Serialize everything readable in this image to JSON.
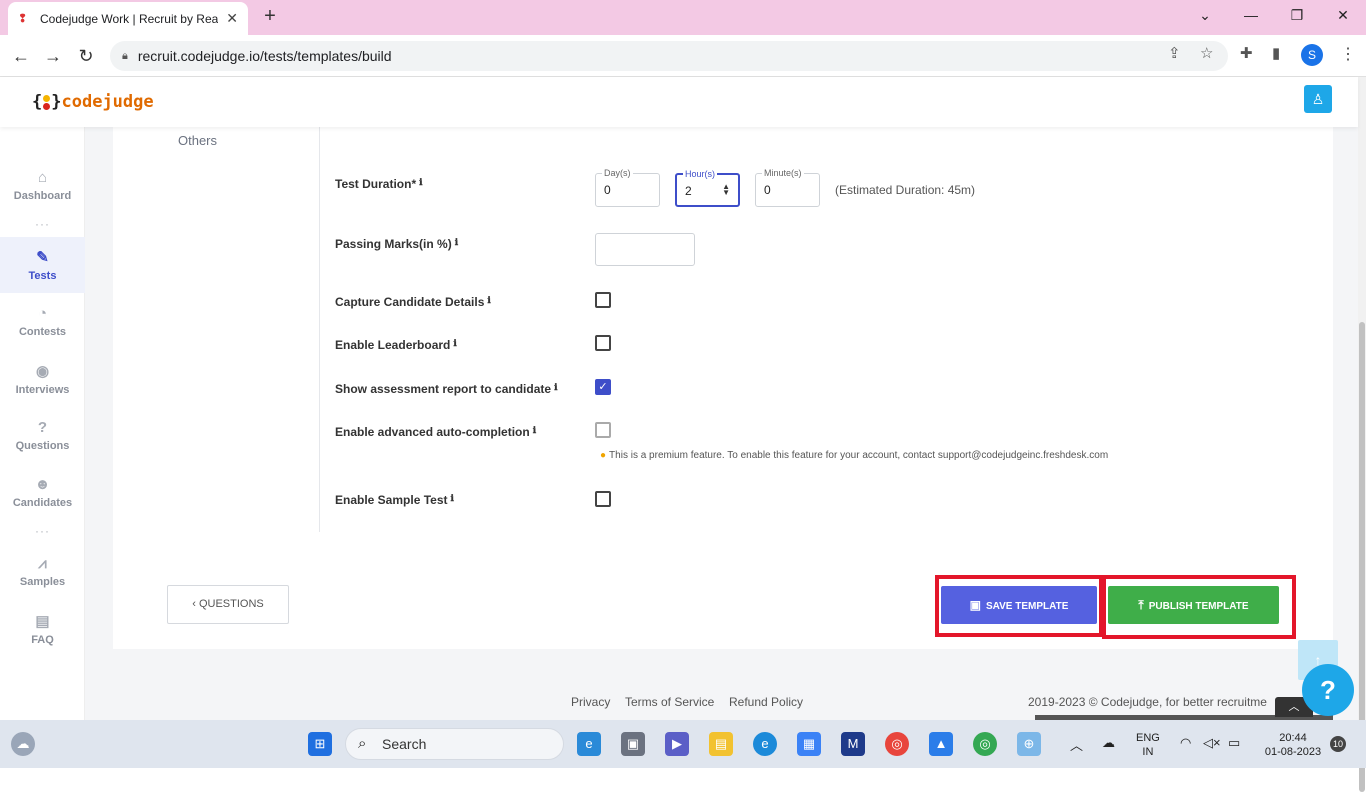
{
  "browser": {
    "tab_title": "Codejudge Work | Recruit by Rea",
    "tab_favicon": "❢",
    "new_tab": "+",
    "url": "recruit.codejudge.io/tests/templates/build",
    "profile_initial": "S"
  },
  "app": {
    "logo_text": "codejudge"
  },
  "sidebar": {
    "items": [
      {
        "label": "Dashboard",
        "icon": "home-icon"
      },
      {
        "label": "Tests",
        "icon": "pen-icon"
      },
      {
        "label": "Contests",
        "icon": "pie-chart-icon"
      },
      {
        "label": "Interviews",
        "icon": "podcast-icon"
      },
      {
        "label": "Questions",
        "icon": "question-circle-icon"
      },
      {
        "label": "Candidates",
        "icon": "users-icon"
      },
      {
        "label": "Samples",
        "icon": "line-chart-icon"
      },
      {
        "label": "FAQ",
        "icon": "chat-icon"
      }
    ]
  },
  "form": {
    "section_label": "Others",
    "test_duration_label": "Test Duration*",
    "days_label": "Day(s)",
    "days_value": "0",
    "hours_label": "Hour(s)",
    "hours_value": "2",
    "minutes_label": "Minute(s)",
    "minutes_value": "0",
    "estimated": "(Estimated Duration: 45m)",
    "passing_marks_label": "Passing Marks(in %)",
    "passing_marks_value": "",
    "capture_label": "Capture Candidate Details",
    "capture_checked": false,
    "leaderboard_label": "Enable Leaderboard",
    "leaderboard_checked": false,
    "report_label": "Show assessment report to candidate",
    "report_checked": true,
    "autocomplete_label": "Enable advanced auto-completion",
    "autocomplete_checked": false,
    "premium_note": "This is a premium feature. To enable this feature for your account, contact support@codejudgeinc.freshdesk.com",
    "sample_label": "Enable Sample Test",
    "sample_checked": false
  },
  "actions": {
    "questions_button": "‹ QUESTIONS",
    "save_button": "SAVE TEMPLATE",
    "publish_button": "PUBLISH TEMPLATE",
    "highlight_color": "#e3162a"
  },
  "footer": {
    "privacy": "Privacy",
    "terms": "Terms of Service",
    "refund": "Refund Policy",
    "copyright": "2019-2023 ©  Codejudge, for better recruitme"
  },
  "taskbar": {
    "search_placeholder": "Search",
    "language": "ENG",
    "region": "IN",
    "time": "20:44",
    "date": "01-08-2023",
    "notifications": "10"
  }
}
